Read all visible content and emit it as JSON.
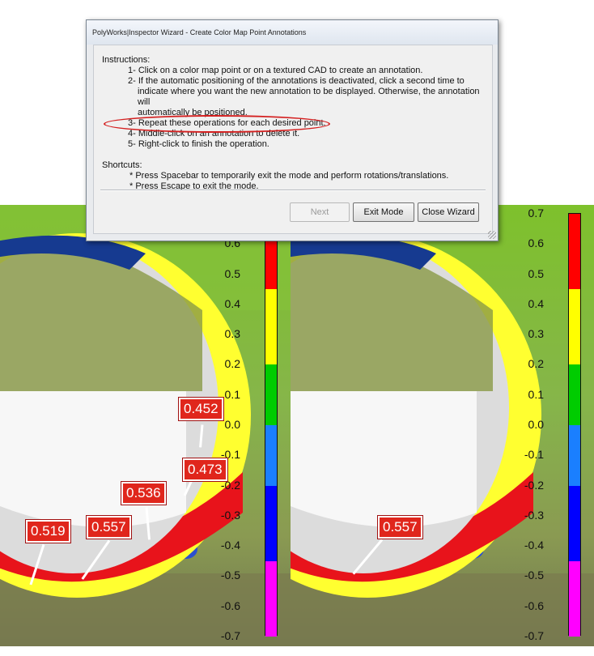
{
  "wizard": {
    "title": "PolyWorks|Inspector Wizard - Create Color Map Point Annotations",
    "instructions_label": "Instructions:",
    "step1": "1- Click on a color map point or on a textured CAD to create an annotation.",
    "step2_line1": "2- If the automatic positioning of the annotations is deactivated, click a second time to",
    "step2_line2": "indicate where you want the new annotation to be displayed. Otherwise, the annotation will",
    "step2_line3": "automatically be positioned.",
    "step3": "3- Repeat these operations for each desired point.",
    "step4": "4- Middle-click on an annotation to delete it.",
    "step5": "5- Right-click to finish the operation.",
    "shortcuts_label": "Shortcuts:",
    "shortcut1": "* Press Spacebar to temporarily exit the mode and perform rotations/translations.",
    "shortcut2": "* Press Escape to exit the mode.",
    "buttons": {
      "next": "Next",
      "exit_mode": "Exit Mode",
      "close_wizard": "Close Wizard"
    }
  },
  "scale_ticks": [
    "0.7",
    "0.6",
    "0.5",
    "0.4",
    "0.3",
    "0.2",
    "0.1",
    "0.0",
    "-0.1",
    "-0.2",
    "-0.3",
    "-0.4",
    "-0.5",
    "-0.6",
    "-0.7"
  ],
  "scale_colors": [
    "#ff00ff",
    "#0000ff",
    "#1a7fff",
    "#00cc00",
    "#ffff00",
    "#ff0000"
  ],
  "left_view": {
    "annotations": [
      "0.452",
      "0.473",
      "0.536",
      "0.557",
      "0.519"
    ]
  },
  "right_view": {
    "annotations": [
      "0.557"
    ]
  }
}
